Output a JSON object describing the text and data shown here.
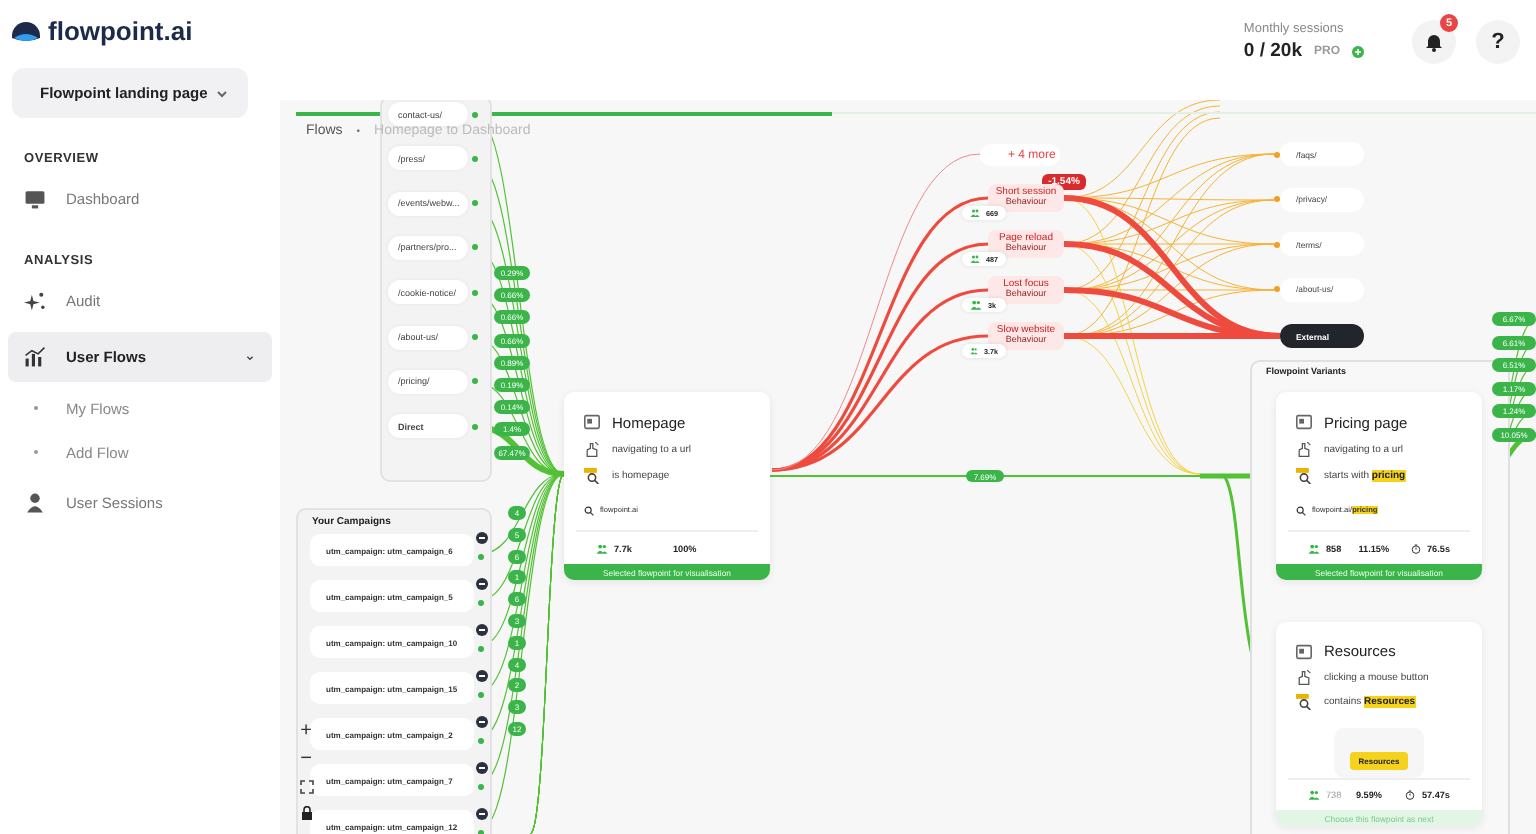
{
  "sidebar": {
    "logo": "flowpoint.ai",
    "project": "Flowpoint landing page",
    "sections": [
      {
        "title": "OVERVIEW",
        "items": [
          {
            "label": "Dashboard",
            "selected": false
          }
        ]
      },
      {
        "title": "ANALYSIS",
        "items": [
          {
            "label": "Audit",
            "selected": false
          },
          {
            "label": "User Flows",
            "selected": true,
            "expanded": true,
            "children": [
              {
                "label": "My Flows",
                "selected": false
              },
              {
                "label": "Add Flow",
                "selected": false
              }
            ]
          },
          {
            "label": "User Sessions",
            "selected": false
          }
        ]
      }
    ]
  },
  "header": {
    "sessions_label": "Monthly sessions",
    "sessions_value": "0 / 20k",
    "plan": "PRO",
    "notifications": "5",
    "help": "?"
  },
  "canvas": {
    "breadcrumb": {
      "root": "Flows",
      "separator": "•",
      "current": "Homepage to Dashboard"
    },
    "source_pages": [
      "contact-us/",
      "/press/",
      "/events/webw...",
      "/partners/pro...",
      "/cookie-notice/",
      "/about-us/",
      "/pricing/",
      "Direct"
    ],
    "source_shares": [
      "0.29%",
      "0.66%",
      "0.66%",
      "0.66%",
      "0.89%",
      "0.19%",
      "0.14%",
      "1.4%",
      "67.47%"
    ],
    "campaigns": {
      "title": "Your Campaigns",
      "items": [
        "utm_campaign: utm_campaign_6",
        "utm_campaign: utm_campaign_5",
        "utm_campaign: utm_campaign_10",
        "utm_campaign: utm_campaign_15",
        "utm_campaign: utm_campaign_2",
        "utm_campaign: utm_campaign_7",
        "utm_campaign: utm_campaign_12"
      ]
    },
    "campaign_counts": [
      "4",
      "5",
      "6",
      "1",
      "6",
      "3",
      "1",
      "4",
      "2",
      "3",
      "12"
    ],
    "zoom_controls": {
      "zoom_in": "+",
      "zoom_out": "−"
    },
    "homepage": {
      "title": "Homepage",
      "action": "navigating to a url",
      "condition": "is homepage",
      "url": "flowpoint.ai",
      "users": "7.7k",
      "share": "100%",
      "footer": "Selected flowpoint for visualisation"
    },
    "link_share": "7.69%",
    "dropoffs": {
      "more": "+ 4 more",
      "change": "-1.54%",
      "items": [
        {
          "label": "Short session",
          "sub": "Behaviour",
          "count": "669"
        },
        {
          "label": "Page reload",
          "sub": "Behaviour",
          "count": "487"
        },
        {
          "label": "Lost focus",
          "sub": "Behaviour",
          "count": "3k"
        },
        {
          "label": "Slow website",
          "sub": "Behaviour",
          "count": "3.7k"
        }
      ]
    },
    "exit_pages": [
      {
        "label": "/faqs/",
        "kind": "page"
      },
      {
        "label": "/privacy/",
        "kind": "page"
      },
      {
        "label": "/terms/",
        "kind": "page"
      },
      {
        "label": "/about-us/",
        "kind": "page"
      },
      {
        "label": "External",
        "kind": "external"
      }
    ],
    "variants": {
      "title": "Flowpoint Variants",
      "cards": [
        {
          "title": "Pricing page",
          "action": "navigating to a url",
          "condition": "starts with **pricing**",
          "url": "flowpoint.ai/**pricing**",
          "users": "858",
          "share": "11.15%",
          "time": "76.5s",
          "footer": "Selected flowpoint for visualisation",
          "selected": true
        },
        {
          "title": "Resources",
          "action": "clicking a mouse button",
          "condition": "contains **Resources**",
          "chip": "Resources",
          "users": "738",
          "share": "9.59%",
          "time": "57.47s",
          "footer": "Choose this flowpoint as next",
          "selected": false
        }
      ]
    },
    "right_shares": [
      "6.67%",
      "6.61%",
      "6.51%",
      "1.17%",
      "1.24%",
      "10.05%"
    ]
  }
}
